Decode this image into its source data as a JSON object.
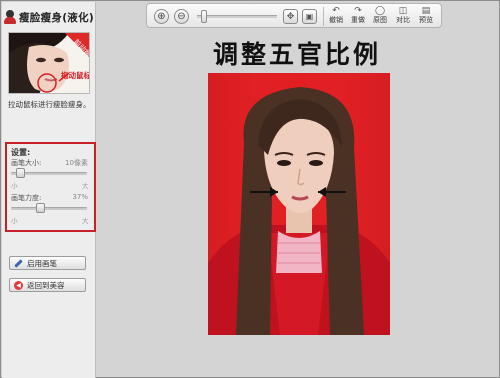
{
  "sidebar": {
    "title": "瘦脸瘦身(液化)",
    "preview_caption": "拖动鼠标",
    "preview_badge": "前动瘦",
    "hint": "拉动鼠标进行瘦脸瘦身。",
    "settings": {
      "title": "设置:",
      "brush_size": {
        "label": "画笔大小:",
        "value_text": "10像素",
        "min": "小",
        "max": "大",
        "level": 0.08
      },
      "brush_strength": {
        "label": "画笔力度:",
        "value_text": "37%",
        "min": "小",
        "max": "大",
        "level": 0.37
      }
    },
    "buttons": {
      "enable_brush": "启用画笔",
      "back": "返回到美容"
    }
  },
  "toolbar": {
    "zoom_in_icon": "zoom-in-icon",
    "zoom_out_icon": "zoom-out-icon",
    "zoom_level": 0.05,
    "undo": "撤销",
    "redo": "重做",
    "original": "原图",
    "compare": "对比",
    "preview": "预览"
  },
  "canvas": {
    "heading": "调整五官比例"
  },
  "colors": {
    "accent_red": "#c8202a",
    "photo_background": "#e11f23"
  }
}
